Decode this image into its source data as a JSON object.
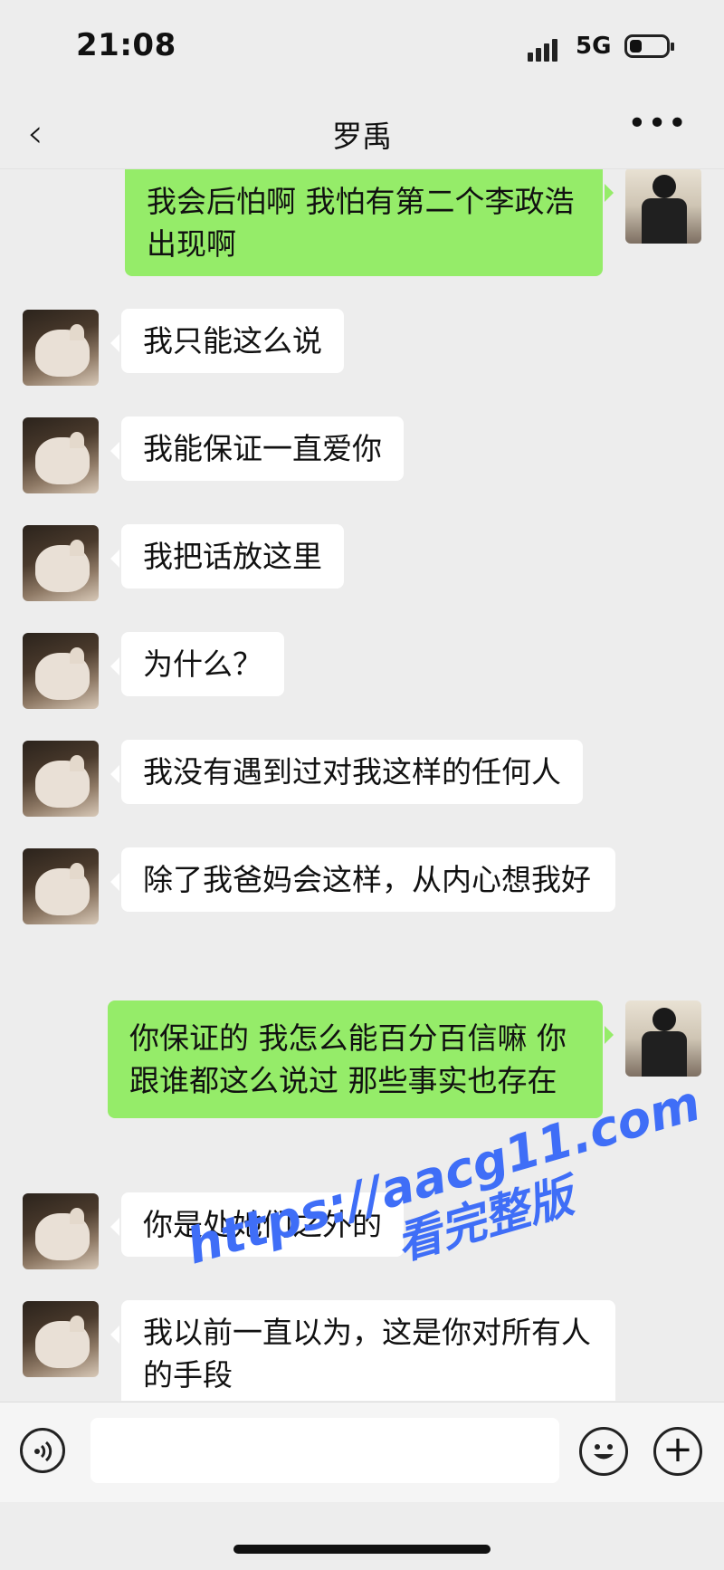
{
  "status_bar": {
    "time": "21:08",
    "network": "5G"
  },
  "header": {
    "back_icon": "chevron-left-icon",
    "title": "罗禹",
    "more_icon": "more-dots-icon"
  },
  "messages": [
    {
      "side": "right",
      "text": "我会后怕啊  我怕有第二个李政浩出现啊"
    },
    {
      "side": "left",
      "text": "我只能这么说"
    },
    {
      "side": "left",
      "text": "我能保证一直爱你"
    },
    {
      "side": "left",
      "text": "我把话放这里"
    },
    {
      "side": "left",
      "text": "为什么？"
    },
    {
      "side": "left",
      "text": "我没有遇到过对我这样的任何人"
    },
    {
      "side": "left",
      "text": "除了我爸妈会这样，从内心想我好"
    },
    {
      "side": "right",
      "text": "你保证的  我怎么能百分百信嘛 你跟谁都这么说过  那些事实也存在"
    },
    {
      "side": "left",
      "text": "你是处她们之外的"
    },
    {
      "side": "left",
      "text": "我以前一直以为，这是你对所有人的手段"
    }
  ],
  "input_bar": {
    "voice_icon": "voice-icon",
    "emoji_icon": "emoji-icon",
    "plus_icon": "plus-icon",
    "input_value": ""
  },
  "watermark": {
    "line1": "https://aacg11.com",
    "line2": "看完整版"
  },
  "colors": {
    "background": "#ededed",
    "sent_bubble": "#95ec69",
    "received_bubble": "#ffffff",
    "watermark": "#3f6ef7"
  }
}
